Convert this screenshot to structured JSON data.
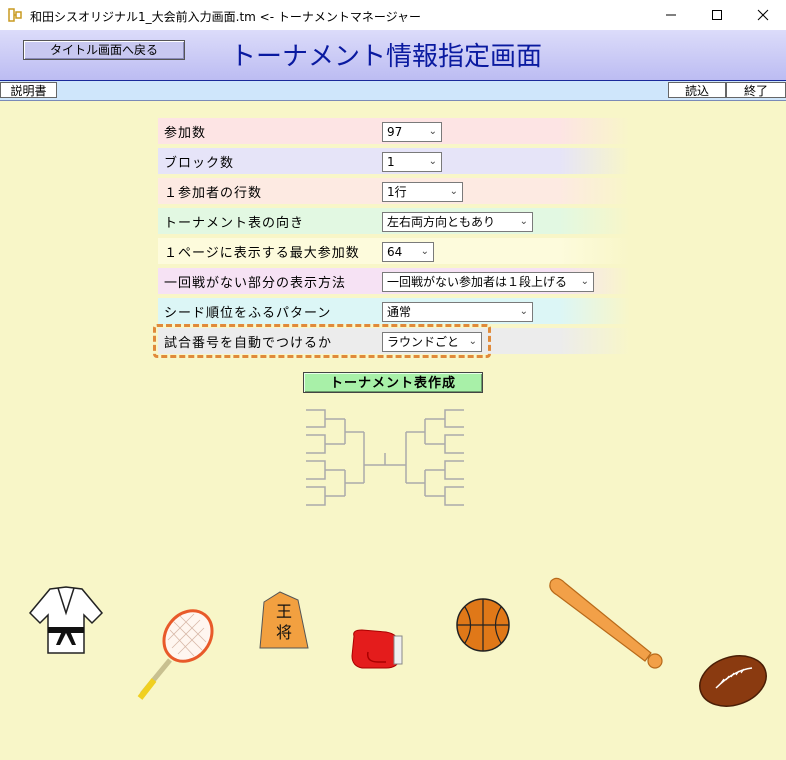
{
  "window": {
    "title": "和田シスオリジナル1_大会前入力画面.tm <- トーナメントマネージャー",
    "minimize_glyph": "—",
    "maximize_glyph": "☐",
    "close_glyph": "✕"
  },
  "header": {
    "back_label": "タイトル画面へ戻る",
    "page_title": "トーナメント情報指定画面"
  },
  "menubar": {
    "manual_label": "説明書",
    "load_label": "読込",
    "quit_label": "終了"
  },
  "form": {
    "rows": [
      {
        "label": "参加数",
        "value": "97"
      },
      {
        "label": "ブロック数",
        "value": "1"
      },
      {
        "label": "１参加者の行数",
        "value": "1行"
      },
      {
        "label": "トーナメント表の向き",
        "value": "左右両方向ともあり"
      },
      {
        "label": "１ページに表示する最大参加数",
        "value": "64"
      },
      {
        "label": "一回戦がない部分の表示方法",
        "value": "一回戦がない参加者は１段上げる"
      },
      {
        "label": "シード順位をふるパターン",
        "value": "通常"
      },
      {
        "label": "試合番号を自動でつけるか",
        "value": "ラウンドごと"
      }
    ],
    "row_colors": [
      "#fde4e4",
      "#e6e4f8",
      "#fdeae2",
      "#e2f8e2",
      "#fdfbdc",
      "#f6e2f4",
      "#dcf6f6",
      "#ececec"
    ]
  },
  "create_button": {
    "label": "トーナメント表作成"
  },
  "icons": {
    "judo_gi": "judo-gi-icon",
    "tennis_racket": "tennis-racket-icon",
    "shogi_piece": "shogi-king-piece-icon",
    "boxing_glove": "boxing-glove-icon",
    "basketball": "basketball-icon",
    "baseball_bat": "baseball-bat-icon",
    "rugby_ball": "rugby-ball-icon"
  },
  "shogi_text": "王将",
  "colors": {
    "title_text": "#0a1aa0",
    "highlight": "#e08a3a",
    "create_button": "#a8f0a8"
  }
}
